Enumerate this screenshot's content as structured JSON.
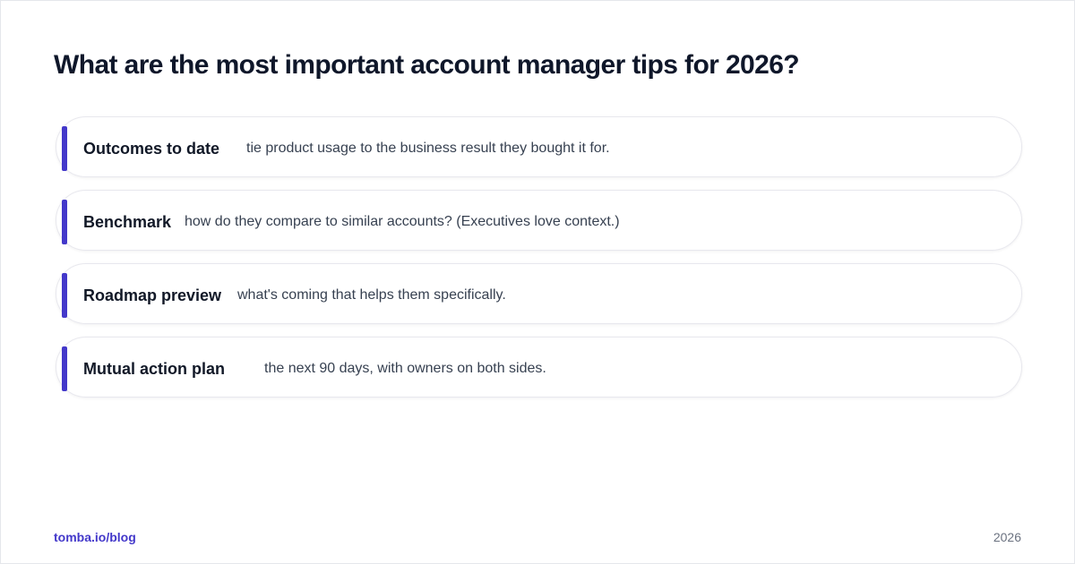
{
  "title": "What are the most important account manager tips for 2026?",
  "tips": [
    {
      "term": "Outcomes to date",
      "description": "tie product usage to the business result they bought it for."
    },
    {
      "term": "Benchmark",
      "description": "how do they compare to similar accounts? (Executives love context.)"
    },
    {
      "term": "Roadmap preview",
      "description": "what's coming that helps them specifically."
    },
    {
      "term": "Mutual action plan",
      "description": "the next 90 days, with owners on both sides."
    }
  ],
  "footer": {
    "link": "tomba.io/blog",
    "year": "2026"
  },
  "colors": {
    "accent": "#4338ca",
    "title": "#0f172a",
    "text": "#374151"
  }
}
